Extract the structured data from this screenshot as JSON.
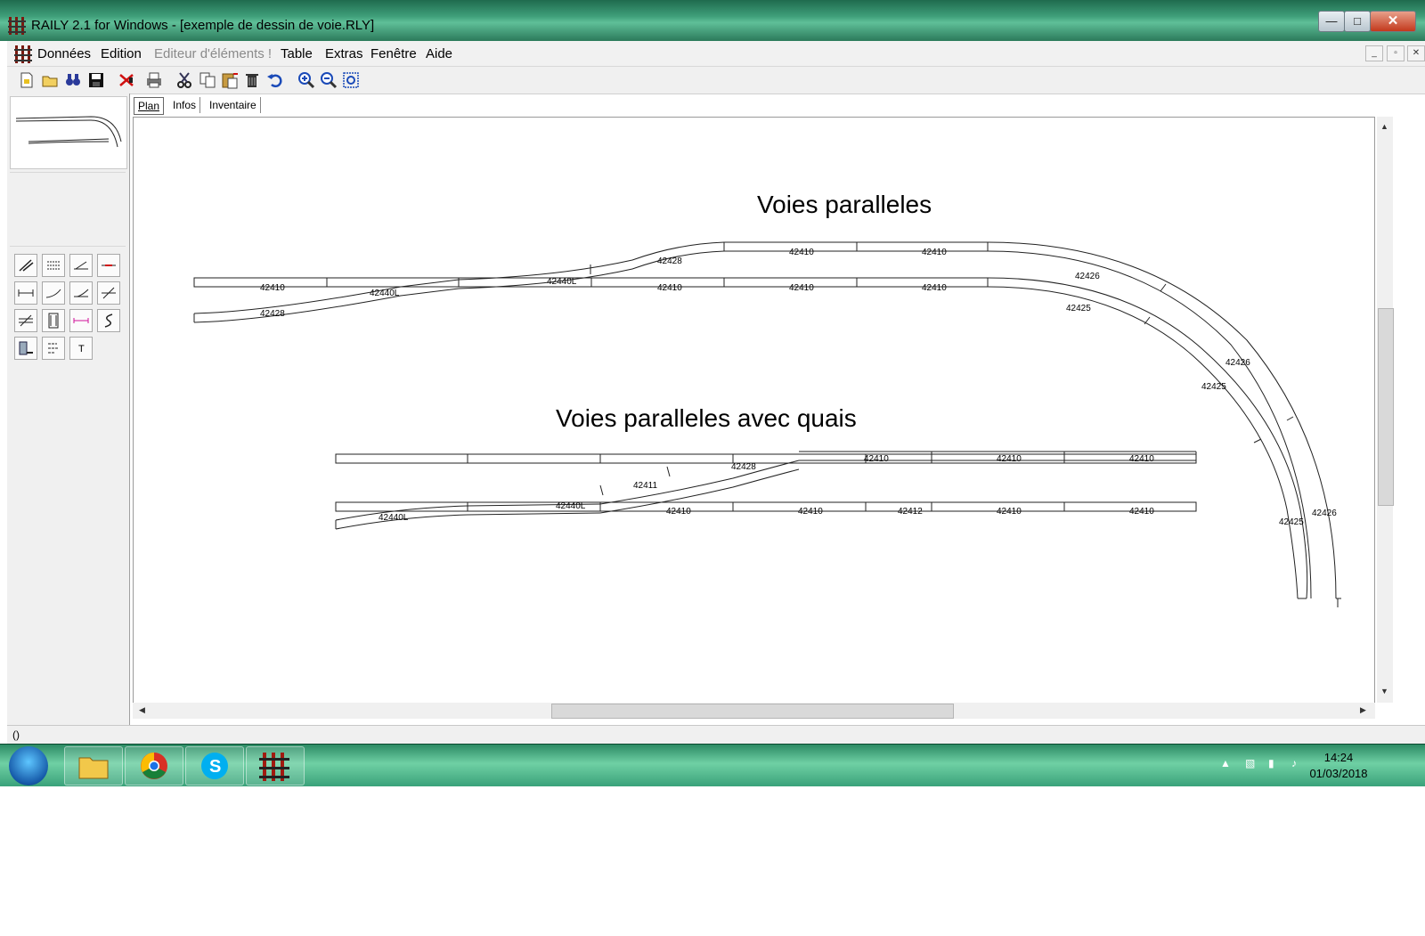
{
  "window": {
    "title": "RAILY 2.1 for Windows - [exemple de dessin de voie.RLY]",
    "controls": [
      "minimize",
      "maximize",
      "close"
    ]
  },
  "menubar": {
    "items": [
      {
        "label": "Données",
        "enabled": true
      },
      {
        "label": "Edition",
        "enabled": true
      },
      {
        "label": "Editeur d'éléments !",
        "enabled": false
      },
      {
        "label": "Table",
        "enabled": true
      },
      {
        "label": "Extras",
        "enabled": true
      },
      {
        "label": "Fenêtre",
        "enabled": true
      },
      {
        "label": "Aide",
        "enabled": true
      }
    ]
  },
  "toolbar": {
    "icons": [
      "new-file-icon",
      "open-folder-icon",
      "binoculars-icon",
      "save-icon",
      "cut-delete-icon",
      "print-icon",
      "cut-icon",
      "copy-icon",
      "paste-icon",
      "trash-icon",
      "undo-icon",
      "zoom-in-icon",
      "zoom-out-icon",
      "zoom-fit-icon"
    ]
  },
  "tool_palette": {
    "icons": [
      "curve-rail-tool-icon",
      "parallel-rail-tool-icon",
      "turnout-left-tool-icon",
      "isolator-tool-icon",
      "straight-track-tool-icon",
      "curved-track-tool-icon",
      "turnout-right-tool-icon",
      "crossing-tool-icon",
      "double-slip-tool-icon",
      "bridge-tool-icon",
      "flex-track-tool-icon",
      "s-curve-tool-icon",
      "platform-tool-icon",
      "signal-tool-icon",
      "text-tool-icon"
    ],
    "text_tool_label": "T"
  },
  "tabs": [
    {
      "label": "Plan",
      "active": true
    },
    {
      "label": "Infos",
      "active": false
    },
    {
      "label": "Inventaire",
      "active": false
    }
  ],
  "plan": {
    "title1": "Voies paralleles",
    "title2": "Voies paralleles avec quais",
    "labels": [
      {
        "text": "42410"
      },
      {
        "text": "42428"
      },
      {
        "text": "42440L"
      },
      {
        "text": "42440L"
      },
      {
        "text": "42428"
      },
      {
        "text": "42410"
      },
      {
        "text": "42410"
      },
      {
        "text": "42410"
      },
      {
        "text": "42410"
      },
      {
        "text": "42410"
      },
      {
        "text": "42426"
      },
      {
        "text": "42425"
      },
      {
        "text": "42426"
      },
      {
        "text": "42425"
      },
      {
        "text": "42425"
      },
      {
        "text": "42426"
      },
      {
        "text": "42428"
      },
      {
        "text": "42411"
      },
      {
        "text": "42410"
      },
      {
        "text": "42410"
      },
      {
        "text": "42410"
      },
      {
        "text": "42440L"
      },
      {
        "text": "42440L"
      },
      {
        "text": "42410"
      },
      {
        "text": "42410"
      },
      {
        "text": "42412"
      },
      {
        "text": "42410"
      },
      {
        "text": "42410"
      }
    ]
  },
  "status": {
    "text": "()"
  },
  "taskbar": {
    "apps": [
      "file-explorer-icon",
      "chrome-icon",
      "skype-icon",
      "raily-icon"
    ],
    "time": "14:24",
    "date": "01/03/2018"
  }
}
